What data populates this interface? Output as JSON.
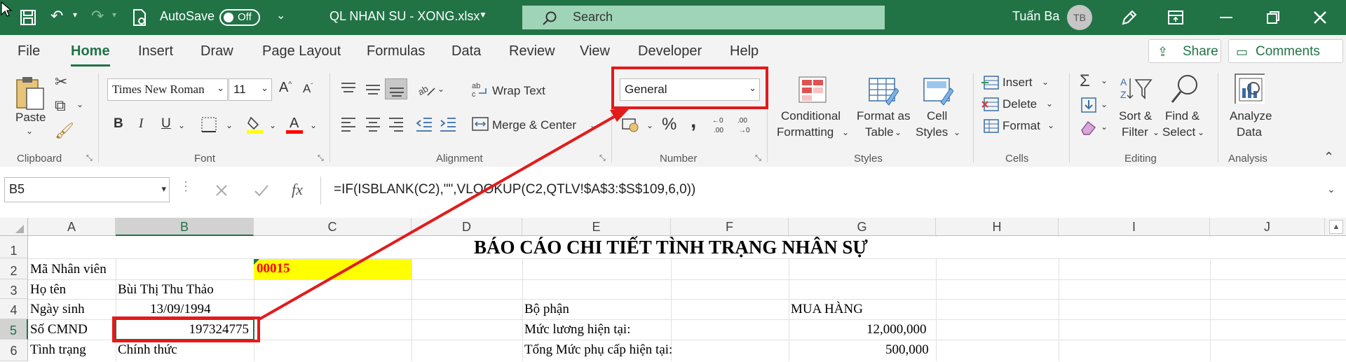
{
  "titlebar": {
    "autosave_label": "AutoSave",
    "autosave_state": "Off",
    "filename": "QL NHAN SU - XONG.xlsx",
    "search_placeholder": "Search",
    "user_name": "Tuấn Ba",
    "user_initials": "TB"
  },
  "tabs": [
    "File",
    "Home",
    "Insert",
    "Draw",
    "Page Layout",
    "Formulas",
    "Data",
    "Review",
    "View",
    "Developer",
    "Help"
  ],
  "active_tab": "Home",
  "share_label": "Share",
  "comments_label": "Comments",
  "ribbon": {
    "clipboard": {
      "paste": "Paste",
      "group": "Clipboard"
    },
    "font": {
      "family": "Times New Roman",
      "size": "11",
      "bold": "B",
      "italic": "I",
      "underline": "U",
      "group": "Font"
    },
    "alignment": {
      "wrap_text": "Wrap Text",
      "merge_center": "Merge & Center",
      "group": "Alignment"
    },
    "number": {
      "format": "General",
      "percent": "%",
      "comma": ",",
      "group": "Number"
    },
    "styles": {
      "conditional": [
        "Conditional",
        "Formatting"
      ],
      "format_table": [
        "Format as",
        "Table"
      ],
      "cell_styles": [
        "Cell",
        "Styles"
      ],
      "group": "Styles"
    },
    "cells": {
      "insert": "Insert",
      "delete": "Delete",
      "format": "Format",
      "group": "Cells"
    },
    "editing": {
      "sort_filter": [
        "Sort &",
        "Filter"
      ],
      "find_select": [
        "Find &",
        "Select"
      ],
      "group": "Editing"
    },
    "analysis": {
      "analyze": [
        "Analyze",
        "Data"
      ],
      "group": "Analysis"
    }
  },
  "formula_bar": {
    "name_box": "B5",
    "fx": "fx",
    "formula": "=IF(ISBLANK(C2),\"\",VLOOKUP(C2,QTLV!$A$3:$S$109,6,0))"
  },
  "columns": [
    "A",
    "B",
    "C",
    "D",
    "E",
    "F",
    "G",
    "H",
    "I",
    "J"
  ],
  "rows": [
    "1",
    "2",
    "3",
    "4",
    "5",
    "6"
  ],
  "sheet": {
    "title": "BÁO CÁO CHI TIẾT TÌNH TRẠNG NHÂN SỰ",
    "a2": "Mã Nhân viên",
    "c2": "00015",
    "a3": "Họ tên",
    "b3": "Bùi Thị Thu Thảo",
    "a4": "Ngày sinh",
    "b4": "13/09/1994",
    "e4": "Bộ phận",
    "g4": "MUA HÀNG",
    "a5": "Số CMND",
    "b5": "197324775",
    "e5": "Mức lương hiện tại:",
    "g5": "12,000,000",
    "a6": "Tình trạng",
    "b6": "Chính thức",
    "e6": "Tổng Mức phụ cấp hiện tại:",
    "g6": "500,000"
  },
  "colors": {
    "excel_green": "#217346",
    "highlight_yellow": "#ffff00",
    "annotation_red": "#e21b1b",
    "id_red": "#ff0000"
  }
}
